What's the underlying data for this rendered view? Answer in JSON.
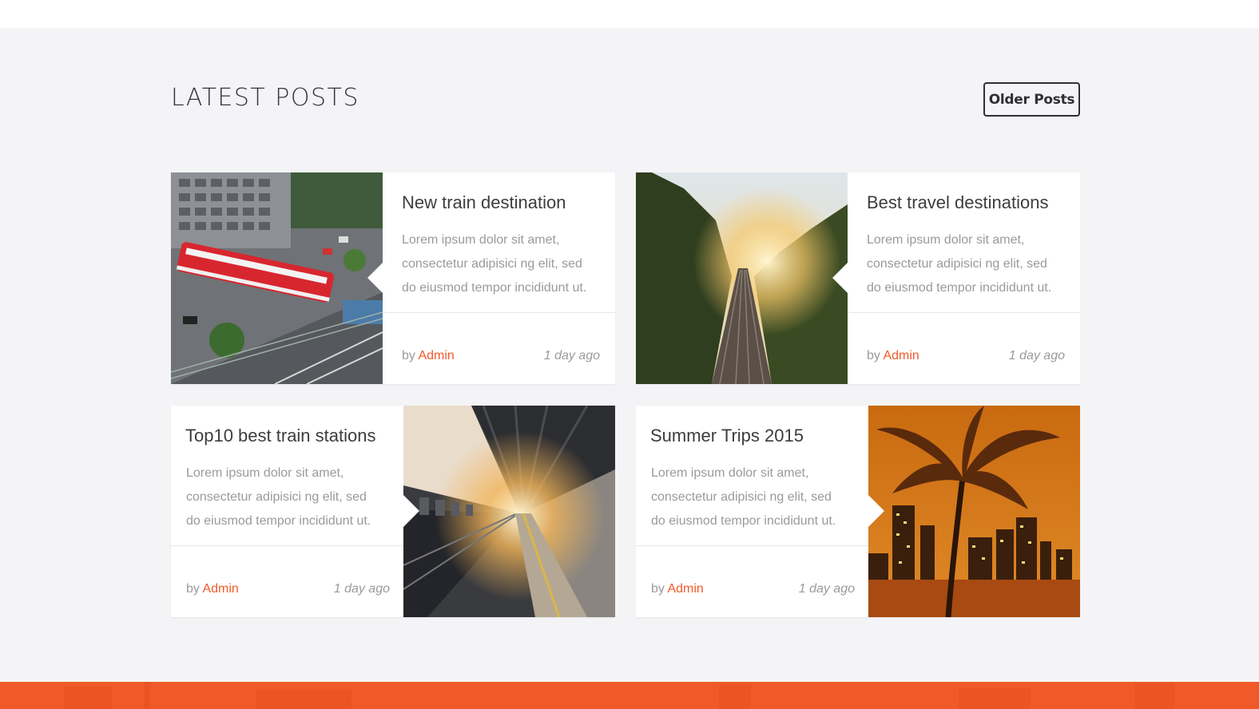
{
  "section": {
    "heading": "LATEST POSTS",
    "older_posts_label": "Older Posts"
  },
  "posts": [
    {
      "title": "New train destination",
      "excerpt": "Lorem ipsum dolor sit amet, consectetur adipisici ng elit, sed do eiusmod tempor incididunt ut.",
      "by": "by",
      "author": "Admin",
      "date": "1 day ago",
      "image": "aerial-city-train-photo"
    },
    {
      "title": "Best travel destinations",
      "excerpt": "Lorem ipsum dolor sit amet, consectetur adipisici ng elit, sed do eiusmod tempor incididunt ut.",
      "by": "by",
      "author": "Admin",
      "date": "1 day ago",
      "image": "sunset-railway-tracks-photo"
    },
    {
      "title": "Top10 best train stations",
      "excerpt": "Lorem ipsum dolor sit amet, consectetur adipisici ng elit, sed do eiusmod tempor incididunt ut.",
      "by": "by",
      "author": "Admin",
      "date": "1 day ago",
      "image": "station-platform-photo"
    },
    {
      "title": "Summer Trips 2015",
      "excerpt": "Lorem ipsum dolor sit amet, consectetur adipisici ng elit, sed do eiusmod tempor incididunt ut.",
      "by": "by",
      "author": "Admin",
      "date": "1 day ago",
      "image": "palm-tree-city-night-photo"
    }
  ],
  "colors": {
    "accent": "#f05a28",
    "section_bg": "#f4f4f6",
    "text_dark": "#3d3d3f",
    "text_muted": "#9a9a9e"
  }
}
